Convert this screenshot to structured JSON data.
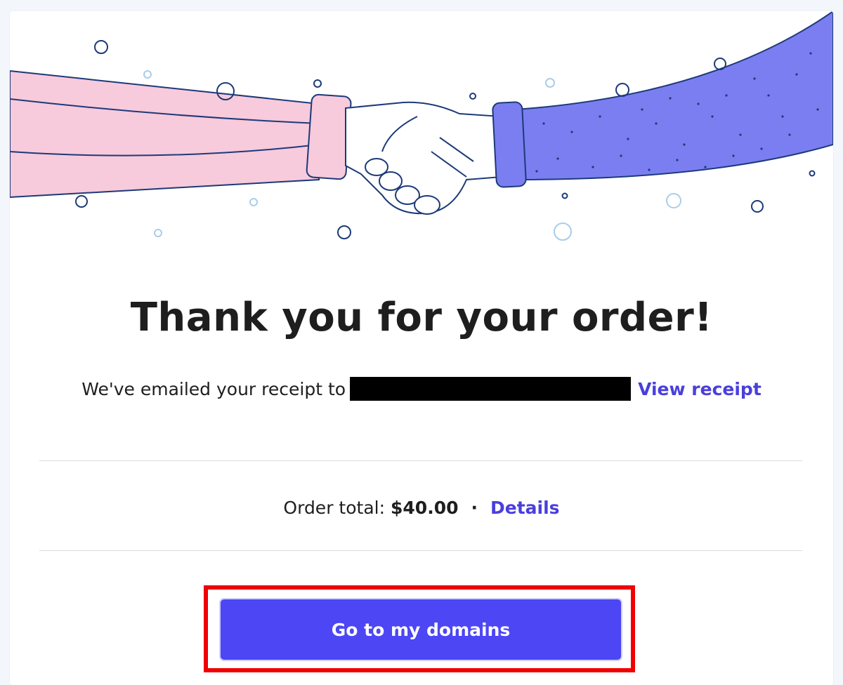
{
  "confirmation": {
    "title": "Thank you for your order!",
    "receipt_text": "We've emailed your receipt to",
    "view_receipt_label": "View receipt",
    "order_total_label": "Order total:",
    "order_total_value": "$40.00",
    "separator": "·",
    "details_label": "Details",
    "cta_label": "Go to my domains"
  },
  "hero": {
    "icon": "handshake-illustration",
    "colors": {
      "left_sleeve": "#f7cadc",
      "right_sleeve": "#7b7ef0",
      "outline": "#1c3a78",
      "skin": "#ffffff",
      "bubble_light": "#a9cdea"
    }
  },
  "colors": {
    "accent": "#4c46f5",
    "link": "#4a3fdc",
    "highlight": "#f00000"
  }
}
